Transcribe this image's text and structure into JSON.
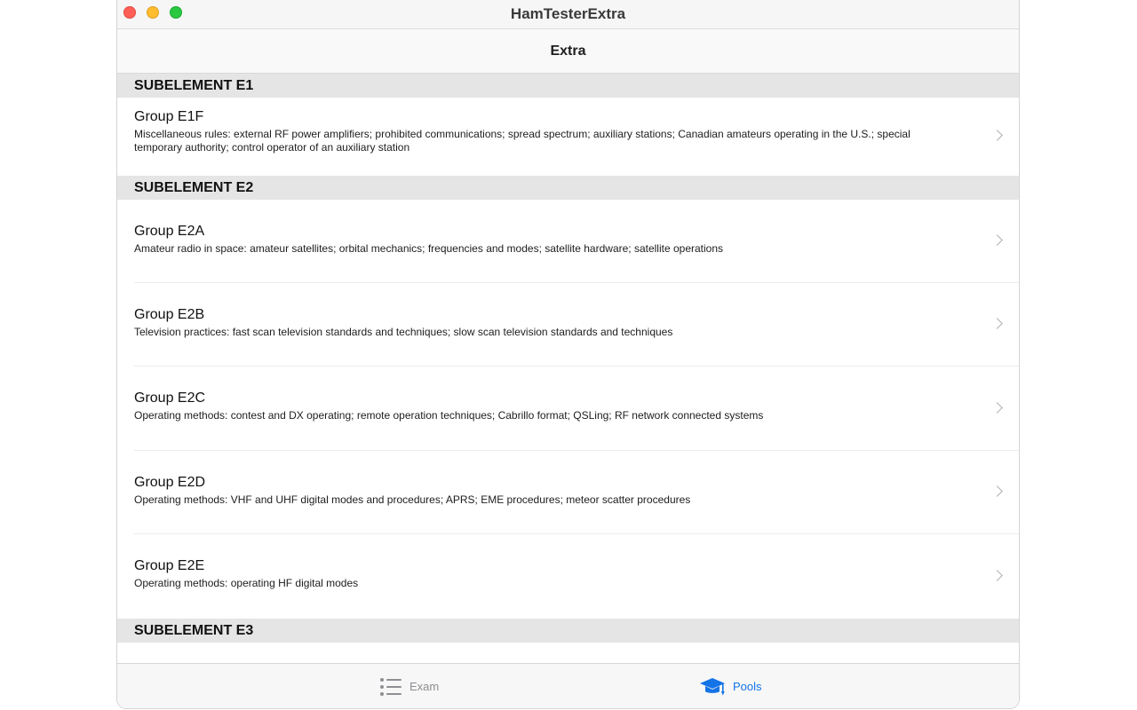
{
  "window": {
    "title": "HamTesterExtra"
  },
  "nav": {
    "title": "Extra"
  },
  "sections": [
    {
      "header": "SUBELEMENT E1",
      "groups": [
        {
          "title": "Group E1F",
          "description": "Miscellaneous rules: external RF power amplifiers; prohibited communications; spread spectrum; auxiliary stations; Canadian amateurs operating in the U.S.; special temporary authority; control operator of an auxiliary station"
        }
      ]
    },
    {
      "header": "SUBELEMENT E2",
      "groups": [
        {
          "title": "Group E2A",
          "description": "Amateur radio in space: amateur satellites; orbital mechanics; frequencies and modes; satellite hardware; satellite operations"
        },
        {
          "title": "Group E2B",
          "description": "Television practices: fast scan television standards and techniques; slow scan television standards and techniques"
        },
        {
          "title": "Group E2C",
          "description": "Operating methods: contest and DX operating; remote operation techniques; Cabrillo format; QSLing; RF network connected systems"
        },
        {
          "title": "Group E2D",
          "description": "Operating methods: VHF and UHF digital modes and procedures; APRS; EME procedures; meteor scatter procedures"
        },
        {
          "title": "Group E2E",
          "description": "Operating methods: operating HF digital modes"
        }
      ]
    },
    {
      "header": "SUBELEMENT E3",
      "groups": []
    }
  ],
  "tabs": [
    {
      "label": "Exam",
      "icon": "list-icon",
      "selected": false
    },
    {
      "label": "Pools",
      "icon": "graduation-cap-icon",
      "selected": true
    }
  ],
  "colors": {
    "accent": "#1473e6",
    "section_bg": "#e5e5e5",
    "close": "#ff5f57",
    "minimize": "#febc2e",
    "maximize": "#28c840"
  }
}
